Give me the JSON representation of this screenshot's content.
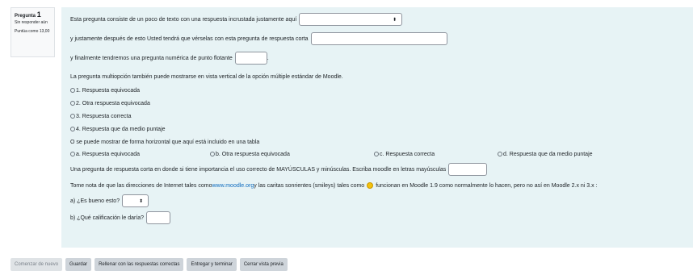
{
  "info": {
    "question_prefix": "Pregunta",
    "question_number": "1",
    "state": "Sin responder aún",
    "grade": "Puntúa como 13,00"
  },
  "q": {
    "line1": "Esta pregunta consiste de un poco de texto con una respuesta incrustada justamente aquí",
    "line2": "y justamente después de esto Usted tendrá que vérselas con esta pregunta de respuesta corta",
    "line3": "y finalmente tendremos una pregunta numérica de punto flotante",
    "line4": "La pregunta multiopción también puede mostrarse en vista vertical de la opción múltiple estándar de Moodle.",
    "vertical_options": [
      "1. Respuesta equivocada",
      "2. Otra respuesta equivocada",
      "3. Respuesta correcta",
      "4. Respuesta que da medio puntaje"
    ],
    "line5": "O se puede mostrar de forma horizontal que aquí está incluido en una tabla",
    "horizontal_options": [
      "a. Respuesta equivocada",
      "b. Otra respuesta equivocada",
      "c. Respuesta correcta",
      "d. Respuesta que da medio puntaje"
    ],
    "line6": "Una pregunta de respuesta corta en donde si tiene importancia el uso correcto de MAYÚSCULAS y minúsculas. Escriba moodle en letras mayúsculas",
    "line7_a": "Tome nota de que las direcciones de Internet tales como ",
    "line7_link": "www.moodle.org",
    "line7_b": " y las caritas sonrientes (smileys) tales como",
    "line7_c": " funcionan en Moodle 1.9 como normalmente lo hacen, pero no así en Moodle 2.x ni 3.x :",
    "line8": "a) ¿Es bueno esto?",
    "line9": "b) ¿Qué calificación le daría?",
    "select_caret": "⬍",
    "punct": "."
  },
  "buttons": [
    "Comenzar de nuevo",
    "Guardar",
    "Rellenar con las respuestas correctas",
    "Entregar y terminar",
    "Cerrar vista previa"
  ]
}
